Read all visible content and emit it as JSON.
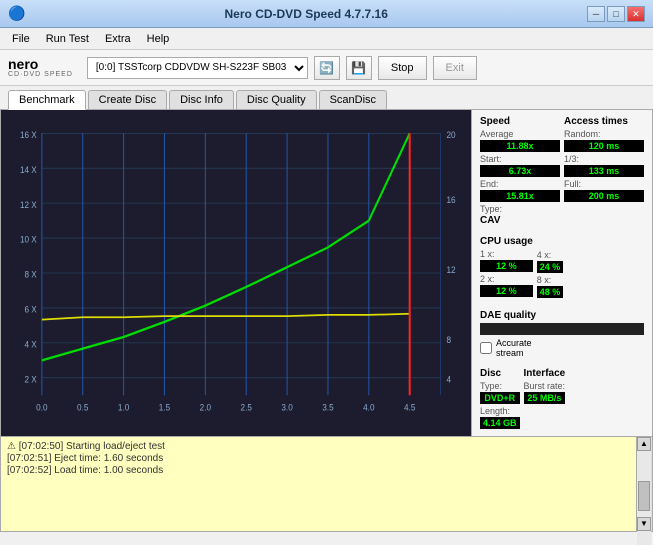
{
  "titlebar": {
    "title": "Nero CD-DVD Speed 4.7.7.16",
    "icon": "🔵",
    "min_btn": "─",
    "max_btn": "□",
    "close_btn": "✕"
  },
  "menubar": {
    "items": [
      "File",
      "Run Test",
      "Extra",
      "Help"
    ]
  },
  "toolbar": {
    "logo_top": "nero",
    "logo_bottom": "CD·DVD SPEED",
    "drive_address": "[0:0]",
    "drive_name": "TSSTcorp CDDVDW SH-S223F SB03",
    "stop_label": "Stop",
    "exit_label": "Exit"
  },
  "tabs": [
    {
      "label": "Benchmark",
      "active": true
    },
    {
      "label": "Create Disc",
      "active": false
    },
    {
      "label": "Disc Info",
      "active": false
    },
    {
      "label": "Disc Quality",
      "active": false
    },
    {
      "label": "ScanDisc",
      "active": false
    }
  ],
  "chart": {
    "bg_color": "#1a1a2e",
    "x_labels": [
      "0.0",
      "0.5",
      "1.0",
      "1.5",
      "2.0",
      "2.5",
      "3.0",
      "3.5",
      "4.0",
      "4.5"
    ],
    "y_labels_left": [
      "16 X",
      "14 X",
      "12 X",
      "10 X",
      "8 X",
      "6 X",
      "4 X",
      "2 X"
    ],
    "y_labels_right": [
      "20",
      "16",
      "12",
      "8",
      "4"
    ]
  },
  "right_panel": {
    "speed_title": "Speed",
    "avg_label": "Average",
    "avg_value": "11.88x",
    "start_label": "Start:",
    "start_value": "6.73x",
    "end_label": "End:",
    "end_value": "15.81x",
    "type_label": "Type:",
    "type_value": "CAV",
    "access_title": "Access times",
    "random_label": "Random:",
    "random_value": "120 ms",
    "one_third_label": "1/3:",
    "one_third_value": "133 ms",
    "full_label": "Full:",
    "full_value": "200 ms",
    "cpu_title": "CPU usage",
    "cpu_1x_label": "1 x:",
    "cpu_1x_value": "12 %",
    "cpu_2x_label": "2 x:",
    "cpu_2x_value": "12 %",
    "cpu_4x_label": "4 x:",
    "cpu_4x_value": "24 %",
    "cpu_8x_label": "8 x:",
    "cpu_8x_value": "48 %",
    "dae_title": "DAE quality",
    "accurate_label": "Accurate",
    "stream_label": "stream",
    "disc_title": "Disc",
    "disc_type_label": "Type:",
    "disc_type_value": "DVD+R",
    "disc_length_label": "Length:",
    "disc_length_value": "4.14 GB",
    "interface_title": "Interface",
    "burst_label": "Burst rate:",
    "burst_value": "25 MB/s"
  },
  "log": {
    "warning_icon": "⚠",
    "entries": [
      {
        "time": "[07:02:50]",
        "text": "Starting load/eject test"
      },
      {
        "time": "[07:02:51]",
        "text": "Eject time: 1.60 seconds"
      },
      {
        "time": "[07:02:52]",
        "text": "Load time: 1.00 seconds"
      }
    ]
  }
}
